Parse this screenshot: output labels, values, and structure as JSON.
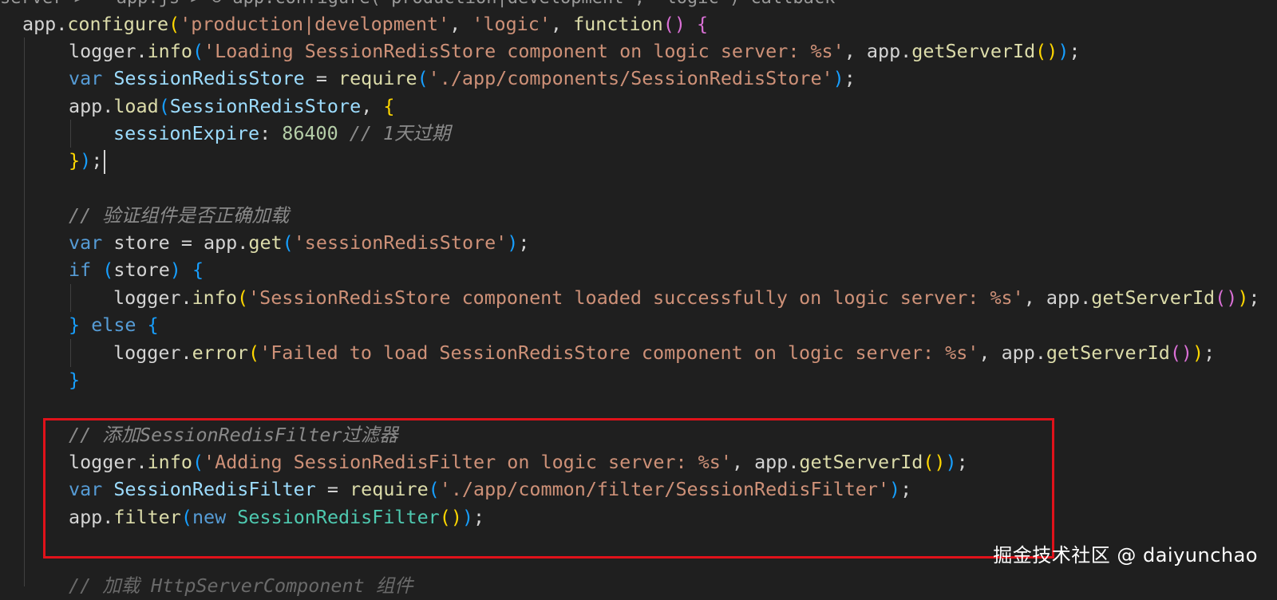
{
  "breadcrumb_partial": "server >   app.js > ⊙ app.configure('production|development', 'logic') callback",
  "code_lines": [
    "app.configure('production|development', 'logic', function() {",
    "logger.info('Loading SessionRedisStore component on logic server: %s', app.getServerId());",
    "var SessionRedisStore = require('./app/components/SessionRedisStore');",
    "app.load(SessionRedisStore, {",
    "sessionExpire: 86400 // 1天过期",
    "});",
    "",
    "// 验证组件是否正确加载",
    "var store = app.get('sessionRedisStore');",
    "if (store) {",
    "logger.info('SessionRedisStore component loaded successfully on logic server: %s', app.getServerId());",
    "} else {",
    "logger.error('Failed to load SessionRedisStore component on logic server: %s', app.getServerId());",
    "}",
    "",
    "// 添加SessionRedisFilter过滤器",
    "logger.info('Adding SessionRedisFilter on logic server: %s', app.getServerId());",
    "var SessionRedisFilter = require('./app/common/filter/SessionRedisFilter');",
    "app.filter(new SessionRedisFilter());",
    "",
    "// 加载 HttpServerComponent 组件"
  ],
  "tokens": {
    "l1": {
      "app": "app",
      "configure": "configure",
      "s1": "'production|development'",
      "s2": "'logic'",
      "function": "function"
    },
    "l2": {
      "logger": "logger",
      "info": "info",
      "s": "'Loading SessionRedisStore component on logic server: %s'",
      "app": "app",
      "getServerId": "getServerId"
    },
    "l3": {
      "var": "var",
      "name": "SessionRedisStore",
      "require": "require",
      "s": "'./app/components/SessionRedisStore'"
    },
    "l4": {
      "app": "app",
      "load": "load",
      "arg": "SessionRedisStore"
    },
    "l5": {
      "key": "sessionExpire",
      "num": "86400",
      "comment": "// 1天过期"
    },
    "l8": {
      "comment": "// 验证组件是否正确加载"
    },
    "l9": {
      "var": "var",
      "name": "store",
      "app": "app",
      "get": "get",
      "s": "'sessionRedisStore'"
    },
    "l10": {
      "if": "if",
      "name": "store"
    },
    "l11": {
      "logger": "logger",
      "info": "info",
      "s": "'SessionRedisStore component loaded successfully on logic server: %s'",
      "app": "app",
      "getServerId": "getServerId"
    },
    "l12": {
      "else": "else"
    },
    "l13": {
      "logger": "logger",
      "error": "error",
      "s": "'Failed to load SessionRedisStore component on logic server: %s'",
      "app": "app",
      "getServerId": "getServerId"
    },
    "l16": {
      "comment": "// 添加SessionRedisFilter过滤器"
    },
    "l17": {
      "logger": "logger",
      "info": "info",
      "s": "'Adding SessionRedisFilter on logic server: %s'",
      "app": "app",
      "getServerId": "getServerId"
    },
    "l18": {
      "var": "var",
      "name": "SessionRedisFilter",
      "require": "require",
      "s": "'./app/common/filter/SessionRedisFilter'"
    },
    "l19": {
      "app": "app",
      "filter": "filter",
      "new": "new",
      "cls": "SessionRedisFilter"
    },
    "l21": {
      "comment": "// 加载 HttpServerComponent 组件"
    }
  },
  "watermark": "掘金技术社区 @ daiyunchao",
  "colors": {
    "background": "#1f1f1f",
    "highlight_border": "#e0121a",
    "keyword": "#569cd6",
    "string": "#ce9178",
    "function": "#dcdcaa",
    "variable": "#9cdcfe",
    "class": "#4ec9b0",
    "number": "#b5cea8",
    "comment": "#6a9955"
  }
}
